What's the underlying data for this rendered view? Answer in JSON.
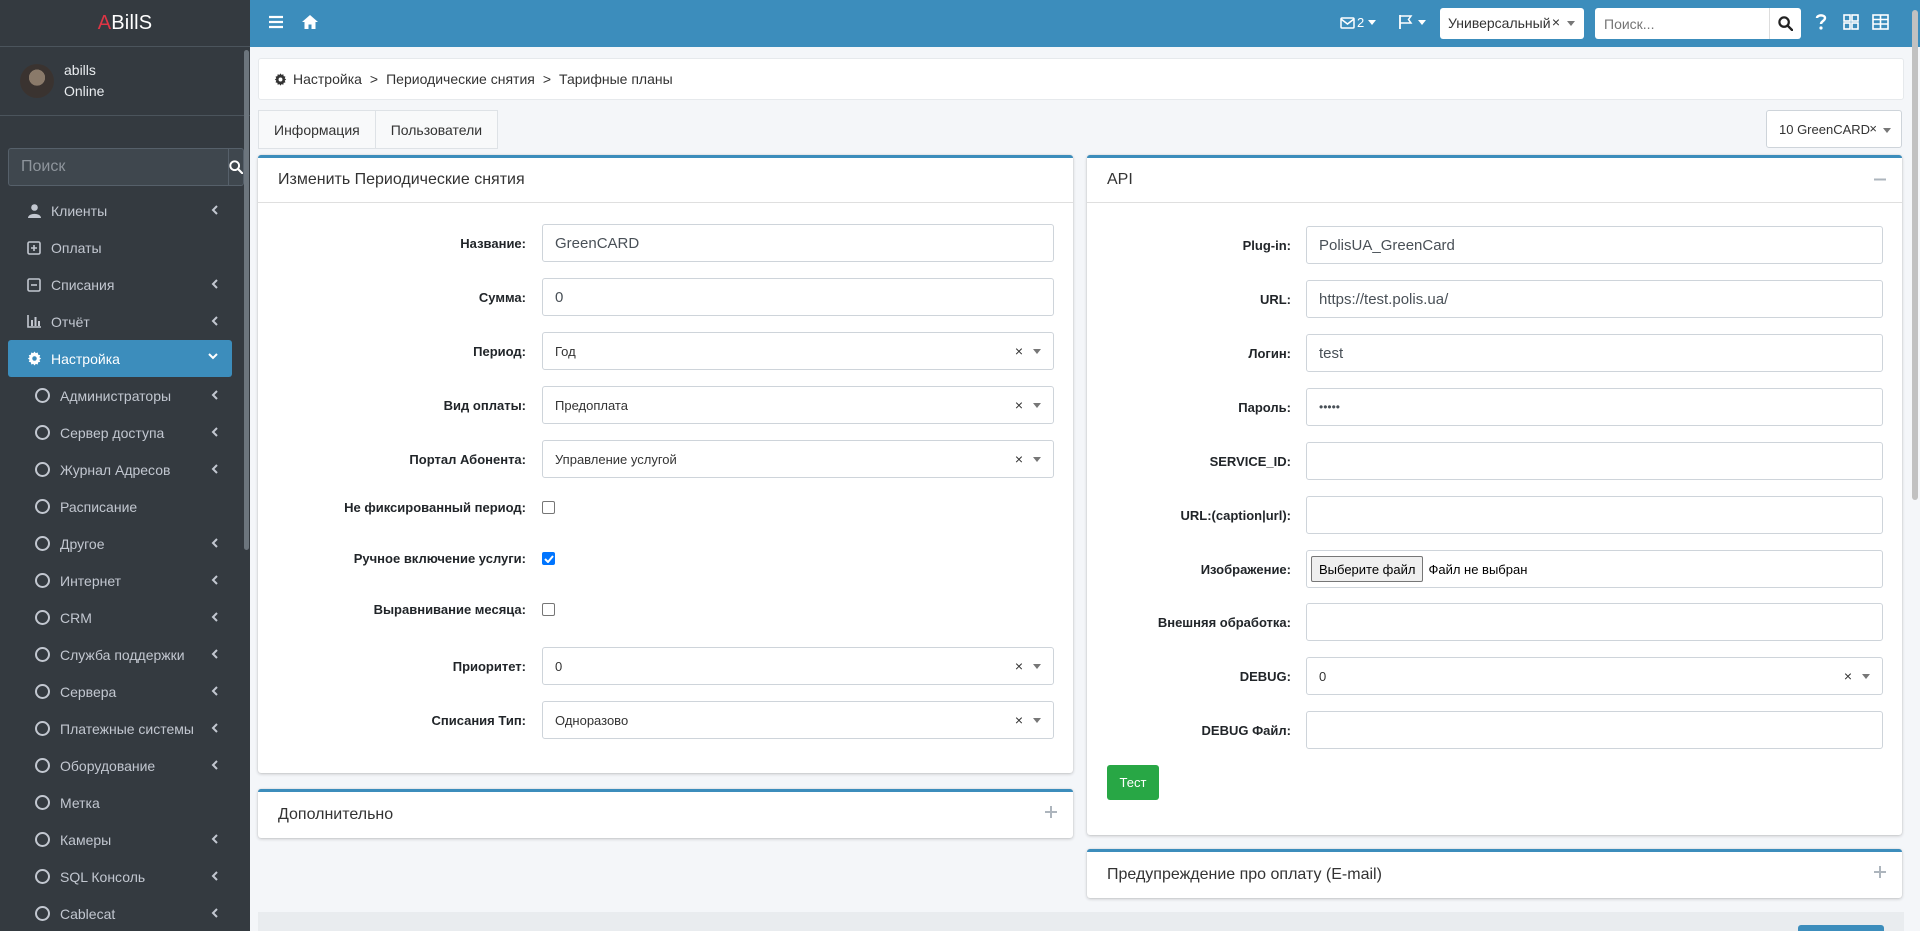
{
  "app": {
    "logo_prefix": "A",
    "logo_rest": "BillS"
  },
  "user": {
    "name": "abills",
    "status": "Online"
  },
  "sidebar": {
    "search_placeholder": "Поиск",
    "items": [
      {
        "label": "Клиенты"
      },
      {
        "label": "Оплаты"
      },
      {
        "label": "Списания"
      },
      {
        "label": "Отчёт"
      },
      {
        "label": "Настройка"
      }
    ],
    "sub_items": [
      {
        "label": "Администраторы"
      },
      {
        "label": "Сервер доступа"
      },
      {
        "label": "Журнал Адресов"
      },
      {
        "label": "Расписание"
      },
      {
        "label": "Другое"
      },
      {
        "label": "Интернет"
      },
      {
        "label": "CRM"
      },
      {
        "label": "Служба поддержки"
      },
      {
        "label": "Сервера"
      },
      {
        "label": "Платежные системы"
      },
      {
        "label": "Оборудование"
      },
      {
        "label": "Метка"
      },
      {
        "label": "Камеры"
      },
      {
        "label": "SQL Консоль"
      },
      {
        "label": "Cablecat"
      }
    ]
  },
  "navbar": {
    "messages_count": "2",
    "mode_select": "Универсальный",
    "search_placeholder": "Поиск..."
  },
  "breadcrumb": {
    "items": [
      "Настройка",
      "Периодические снятия",
      "Тарифные планы"
    ],
    "separator": ">"
  },
  "tabs": [
    "Информация",
    "Пользователи"
  ],
  "tp_select": "10 GreenCARD",
  "left_card": {
    "title": "Изменить Периодические снятия",
    "fields": {
      "name": {
        "label": "Название:",
        "value": "GreenCARD"
      },
      "sum": {
        "label": "Сумма:",
        "value": "0"
      },
      "period": {
        "label": "Период:",
        "value": "Год"
      },
      "payment_type": {
        "label": "Вид оплаты:",
        "value": "Предоплата"
      },
      "portal": {
        "label": "Портал Абонента:",
        "value": "Управление услугой"
      },
      "not_fixed": {
        "label": "Не фиксированный период:",
        "checked": false
      },
      "manual": {
        "label": "Ручное включение услуги:",
        "checked": true
      },
      "align": {
        "label": "Выравнивание месяца:",
        "checked": false
      },
      "priority": {
        "label": "Приоритет:",
        "value": "0"
      },
      "fee_type": {
        "label": "Списания Тип:",
        "value": "Одноразово"
      }
    }
  },
  "extra_card": {
    "title": "Дополнительно"
  },
  "api_card": {
    "title": "API",
    "fields": {
      "plugin": {
        "label": "Plug-in:",
        "value": "PolisUA_GreenCard"
      },
      "url": {
        "label": "URL:",
        "value": "https://test.polis.ua/"
      },
      "login": {
        "label": "Логин:",
        "value": "test"
      },
      "password": {
        "label": "Пароль:",
        "value": "•••••"
      },
      "service_id": {
        "label": "SERVICE_ID:",
        "value": ""
      },
      "url_caption": {
        "label": "URL:(caption|url):",
        "value": ""
      },
      "image": {
        "label": "Изображение:",
        "button": "Выберите файл",
        "status": "Файл не выбран"
      },
      "external": {
        "label": "Внешняя обработка:",
        "value": ""
      },
      "debug": {
        "label": "DEBUG:",
        "value": "0"
      },
      "debug_file": {
        "label": "DEBUG Файл:",
        "value": ""
      }
    },
    "test_button": "Тест"
  },
  "warning_card": {
    "title": "Предупреждение про оплату (E-mail)"
  },
  "colors": {
    "accent": "#3c8dbc",
    "sidebar": "#343a40",
    "success": "#28a745"
  }
}
